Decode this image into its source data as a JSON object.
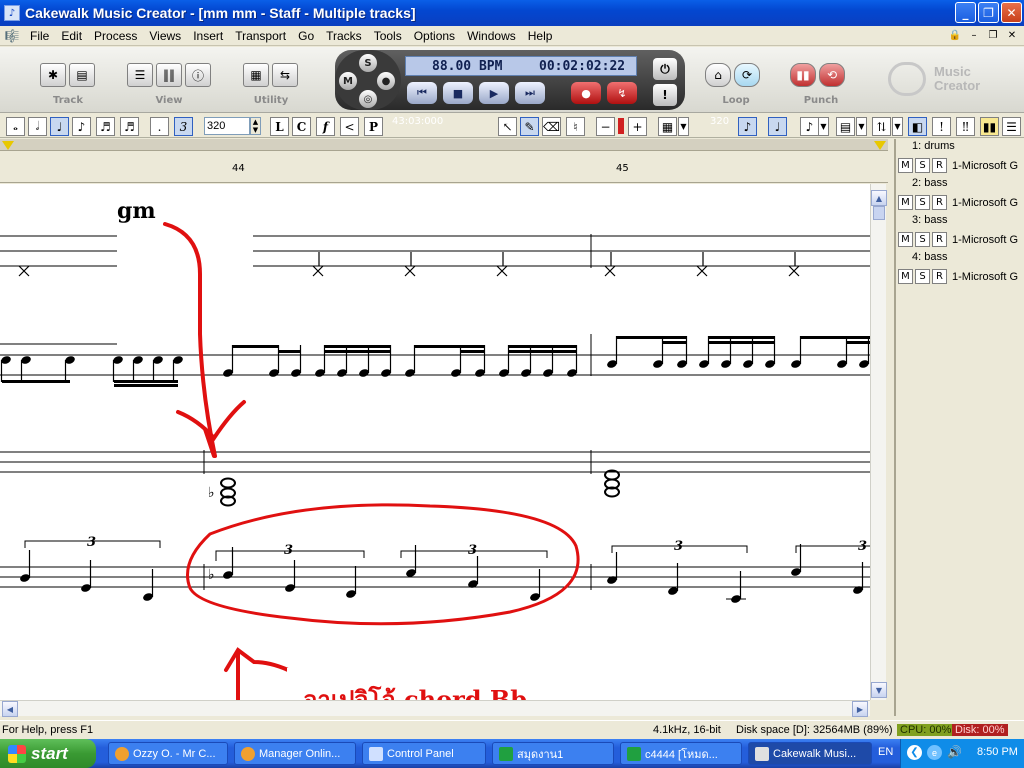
{
  "window": {
    "title": "Cakewalk Music Creator - [mm  mm - Staff - Multiple tracks]",
    "app_icon": "piano-keys-icon"
  },
  "menu": {
    "items": [
      "File",
      "Edit",
      "Process",
      "Views",
      "Insert",
      "Transport",
      "Go",
      "Tracks",
      "Tools",
      "Options",
      "Windows",
      "Help"
    ]
  },
  "control_bar": {
    "group_labels": [
      "Track",
      "View",
      "Utility",
      "Loop",
      "Punch"
    ],
    "msr": {
      "s": "S",
      "m": "M"
    },
    "tempo": "88.00 BPM",
    "time": "00:02:02:22",
    "logo_line1": "Music",
    "logo_line2": "Creator"
  },
  "staff_toolbar": {
    "dot_label": ".",
    "triplet_label": "3",
    "zoom_value": "320",
    "dynamics": [
      "L",
      "C",
      "f",
      "<",
      "P"
    ],
    "position": "43:03:000",
    "resolution": "320"
  },
  "ruler": {
    "measure_a": "44",
    "measure_b": "45"
  },
  "score": {
    "chord_symbol": "gm",
    "tuplet_marks": [
      "3",
      "3",
      "3",
      "3",
      "3"
    ],
    "annotation": "อาเปจิโอ้ chord Bb",
    "annotation_prefix": "_"
  },
  "tracks": [
    {
      "name": "1: drums",
      "output": "1-Microsoft G"
    },
    {
      "name": "2: bass",
      "output": "1-Microsoft G"
    },
    {
      "name": "3: bass",
      "output": "1-Microsoft G"
    },
    {
      "name": "4: bass",
      "output": "1-Microsoft G"
    }
  ],
  "track_buttons": {
    "m": "M",
    "s": "S",
    "r": "R"
  },
  "status": {
    "help": "For Help, press F1",
    "audio": "4.1kHz, 16-bit",
    "disk_space": "Disk space [D]: 32564MB (89%)",
    "cpu": "CPU: 00%",
    "disk": "Disk: 00%"
  },
  "taskbar": {
    "start": "start",
    "tasks": [
      "Ozzy O. - Mr C...",
      "Manager Onlin...",
      "Control Panel",
      "สมุดงาน1",
      "c4444  [โหมด...",
      "Cakewalk Musi..."
    ],
    "lang": "EN",
    "clock": "8:50 PM"
  },
  "colors": {
    "annotation_red": "#e01010",
    "title_blue": "#0a5fe8",
    "taskbar_blue": "#245edb"
  }
}
